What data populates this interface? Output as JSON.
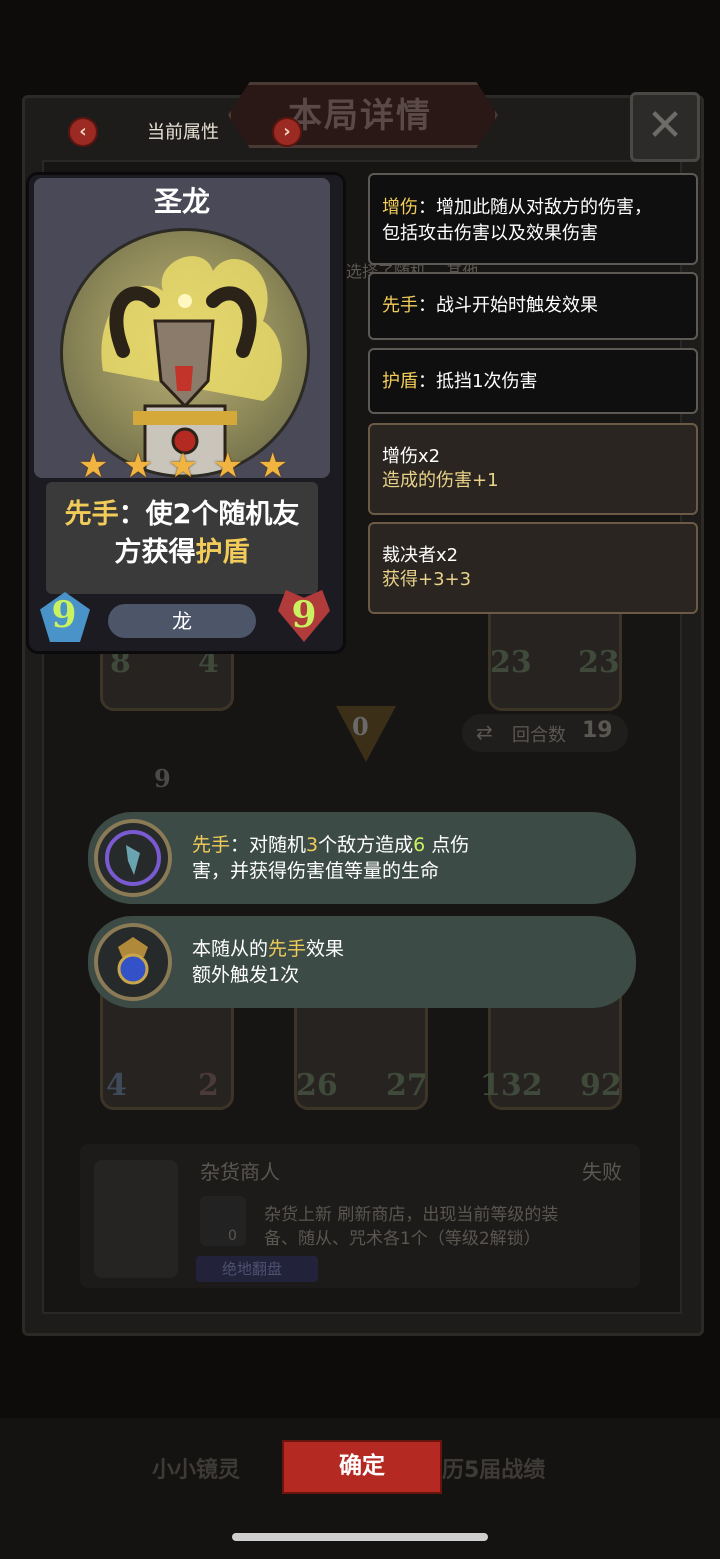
{
  "header": {
    "title": "本局详情",
    "close_glyph": "✕"
  },
  "attr_nav": {
    "label": "当前属性",
    "prev_glyph": "‹",
    "next_glyph": "›"
  },
  "hero_card": {
    "name": "圣龙",
    "stars": 5,
    "star_glyph": "★",
    "ability": {
      "keyword": "先手",
      "text_a": "：使2个随机友",
      "text_b": "方获得",
      "keyword2": "护盾"
    },
    "attack": "9",
    "health": "9",
    "tribe": "龙"
  },
  "tooltips": [
    {
      "keyword": "增伤",
      "text": "：增加此随从对敌方的伤害，",
      "text2": "包括攻击伤害以及效果伤害"
    },
    {
      "keyword": "先手",
      "text": "：战斗开始时触发效果"
    },
    {
      "keyword": "护盾",
      "text": "：抵挡1次伤害"
    }
  ],
  "buffs": [
    {
      "title": "增伤x2",
      "sub": "造成的伤害+1"
    },
    {
      "title": "裁决者x2",
      "sub": "获得+3+3"
    }
  ],
  "effects": [
    {
      "kw": "先手",
      "a": "：对随机",
      "n1": "3",
      "b": "个敌方造成",
      "n2": "6",
      "c": " 点伤",
      "d": "害，并获得伤害值等量的生命"
    },
    {
      "a": "本随从的",
      "kw": "先手",
      "b": "效果",
      "c": "额外触发1次"
    }
  ],
  "background": {
    "round_label": "回合数",
    "round_value": "19",
    "arrow_value": "0",
    "stats_row1": [
      "8",
      "4",
      "23",
      "23"
    ],
    "stats_row2": [
      "4",
      "2",
      "26",
      "27",
      "132",
      "92"
    ],
    "level_badge": "9",
    "shop_name": "杂货商人",
    "shop_status": "失败",
    "shop_desc1": "杂货上新 刷新商店，出现当前等级的装",
    "shop_desc2": "备、随从、咒术各1个（等级2解锁）",
    "shop_tag": "绝地翻盘",
    "shop_cost": "0",
    "footer_left": "小小镜灵",
    "footer_right": "历5届战绩",
    "top_ghost": "选择了随机... 其他"
  },
  "confirm_label": "确定",
  "colors": {
    "keyword": "#f2cc5a",
    "number": "#c9f160",
    "confirm": "#b42a22",
    "bubble": "#3c4b45"
  }
}
